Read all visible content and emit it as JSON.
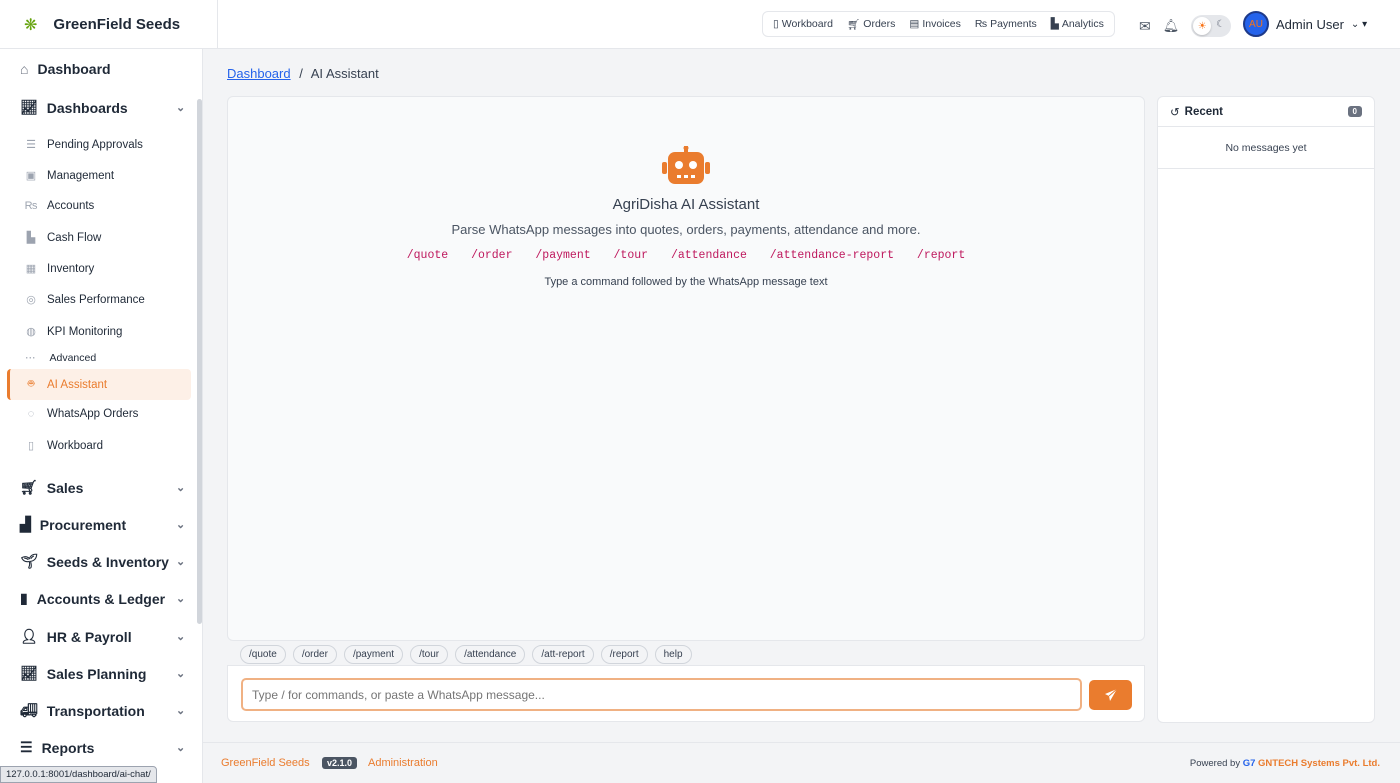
{
  "brand": {
    "name": "GreenField Seeds"
  },
  "topnav": [
    "Workboard",
    "Orders",
    "Invoices",
    "Payments",
    "Analytics"
  ],
  "user": {
    "initials": "AU",
    "name": "Admin User"
  },
  "sidebar": {
    "dashboard": "Dashboard",
    "dashboards": "Dashboards",
    "items": [
      "Pending Approvals",
      "Management",
      "Accounts",
      "Cash Flow",
      "Inventory",
      "Sales Performance",
      "KPI Monitoring"
    ],
    "advanced": "Advanced",
    "adv_items": [
      "AI Assistant",
      "WhatsApp Orders",
      "Workboard"
    ],
    "groups": [
      "Sales",
      "Procurement",
      "Seeds & Inventory",
      "Accounts & Ledger",
      "HR & Payroll",
      "Sales Planning",
      "Transportation",
      "Reports"
    ]
  },
  "breadcrumb": {
    "root": "Dashboard",
    "sep": "/",
    "current": "AI Assistant"
  },
  "assistant": {
    "title": "AgriDisha AI Assistant",
    "description": "Parse WhatsApp messages into quotes, orders, payments, attendance and more.",
    "commands": [
      "/quote",
      "/order",
      "/payment",
      "/tour",
      "/attendance",
      "/attendance-report",
      "/report"
    ],
    "hint": "Type a command followed by the WhatsApp message text"
  },
  "chips": [
    "/quote",
    "/order",
    "/payment",
    "/tour",
    "/attendance",
    "/att-report",
    "/report",
    "help"
  ],
  "input": {
    "placeholder": "Type / for commands, or paste a WhatsApp message..."
  },
  "recent": {
    "title": "Recent",
    "count": "0",
    "empty": "No messages yet"
  },
  "footer": {
    "brand": "GreenField Seeds",
    "version": "v2.1.0",
    "admin": "Administration",
    "powered": "Powered by",
    "company": "GNTECH Systems Pvt. Ltd."
  },
  "status_url": "127.0.0.1:8001/dashboard/ai-chat/",
  "colors": {
    "accent": "#ea7c2e",
    "link": "#2563eb"
  }
}
